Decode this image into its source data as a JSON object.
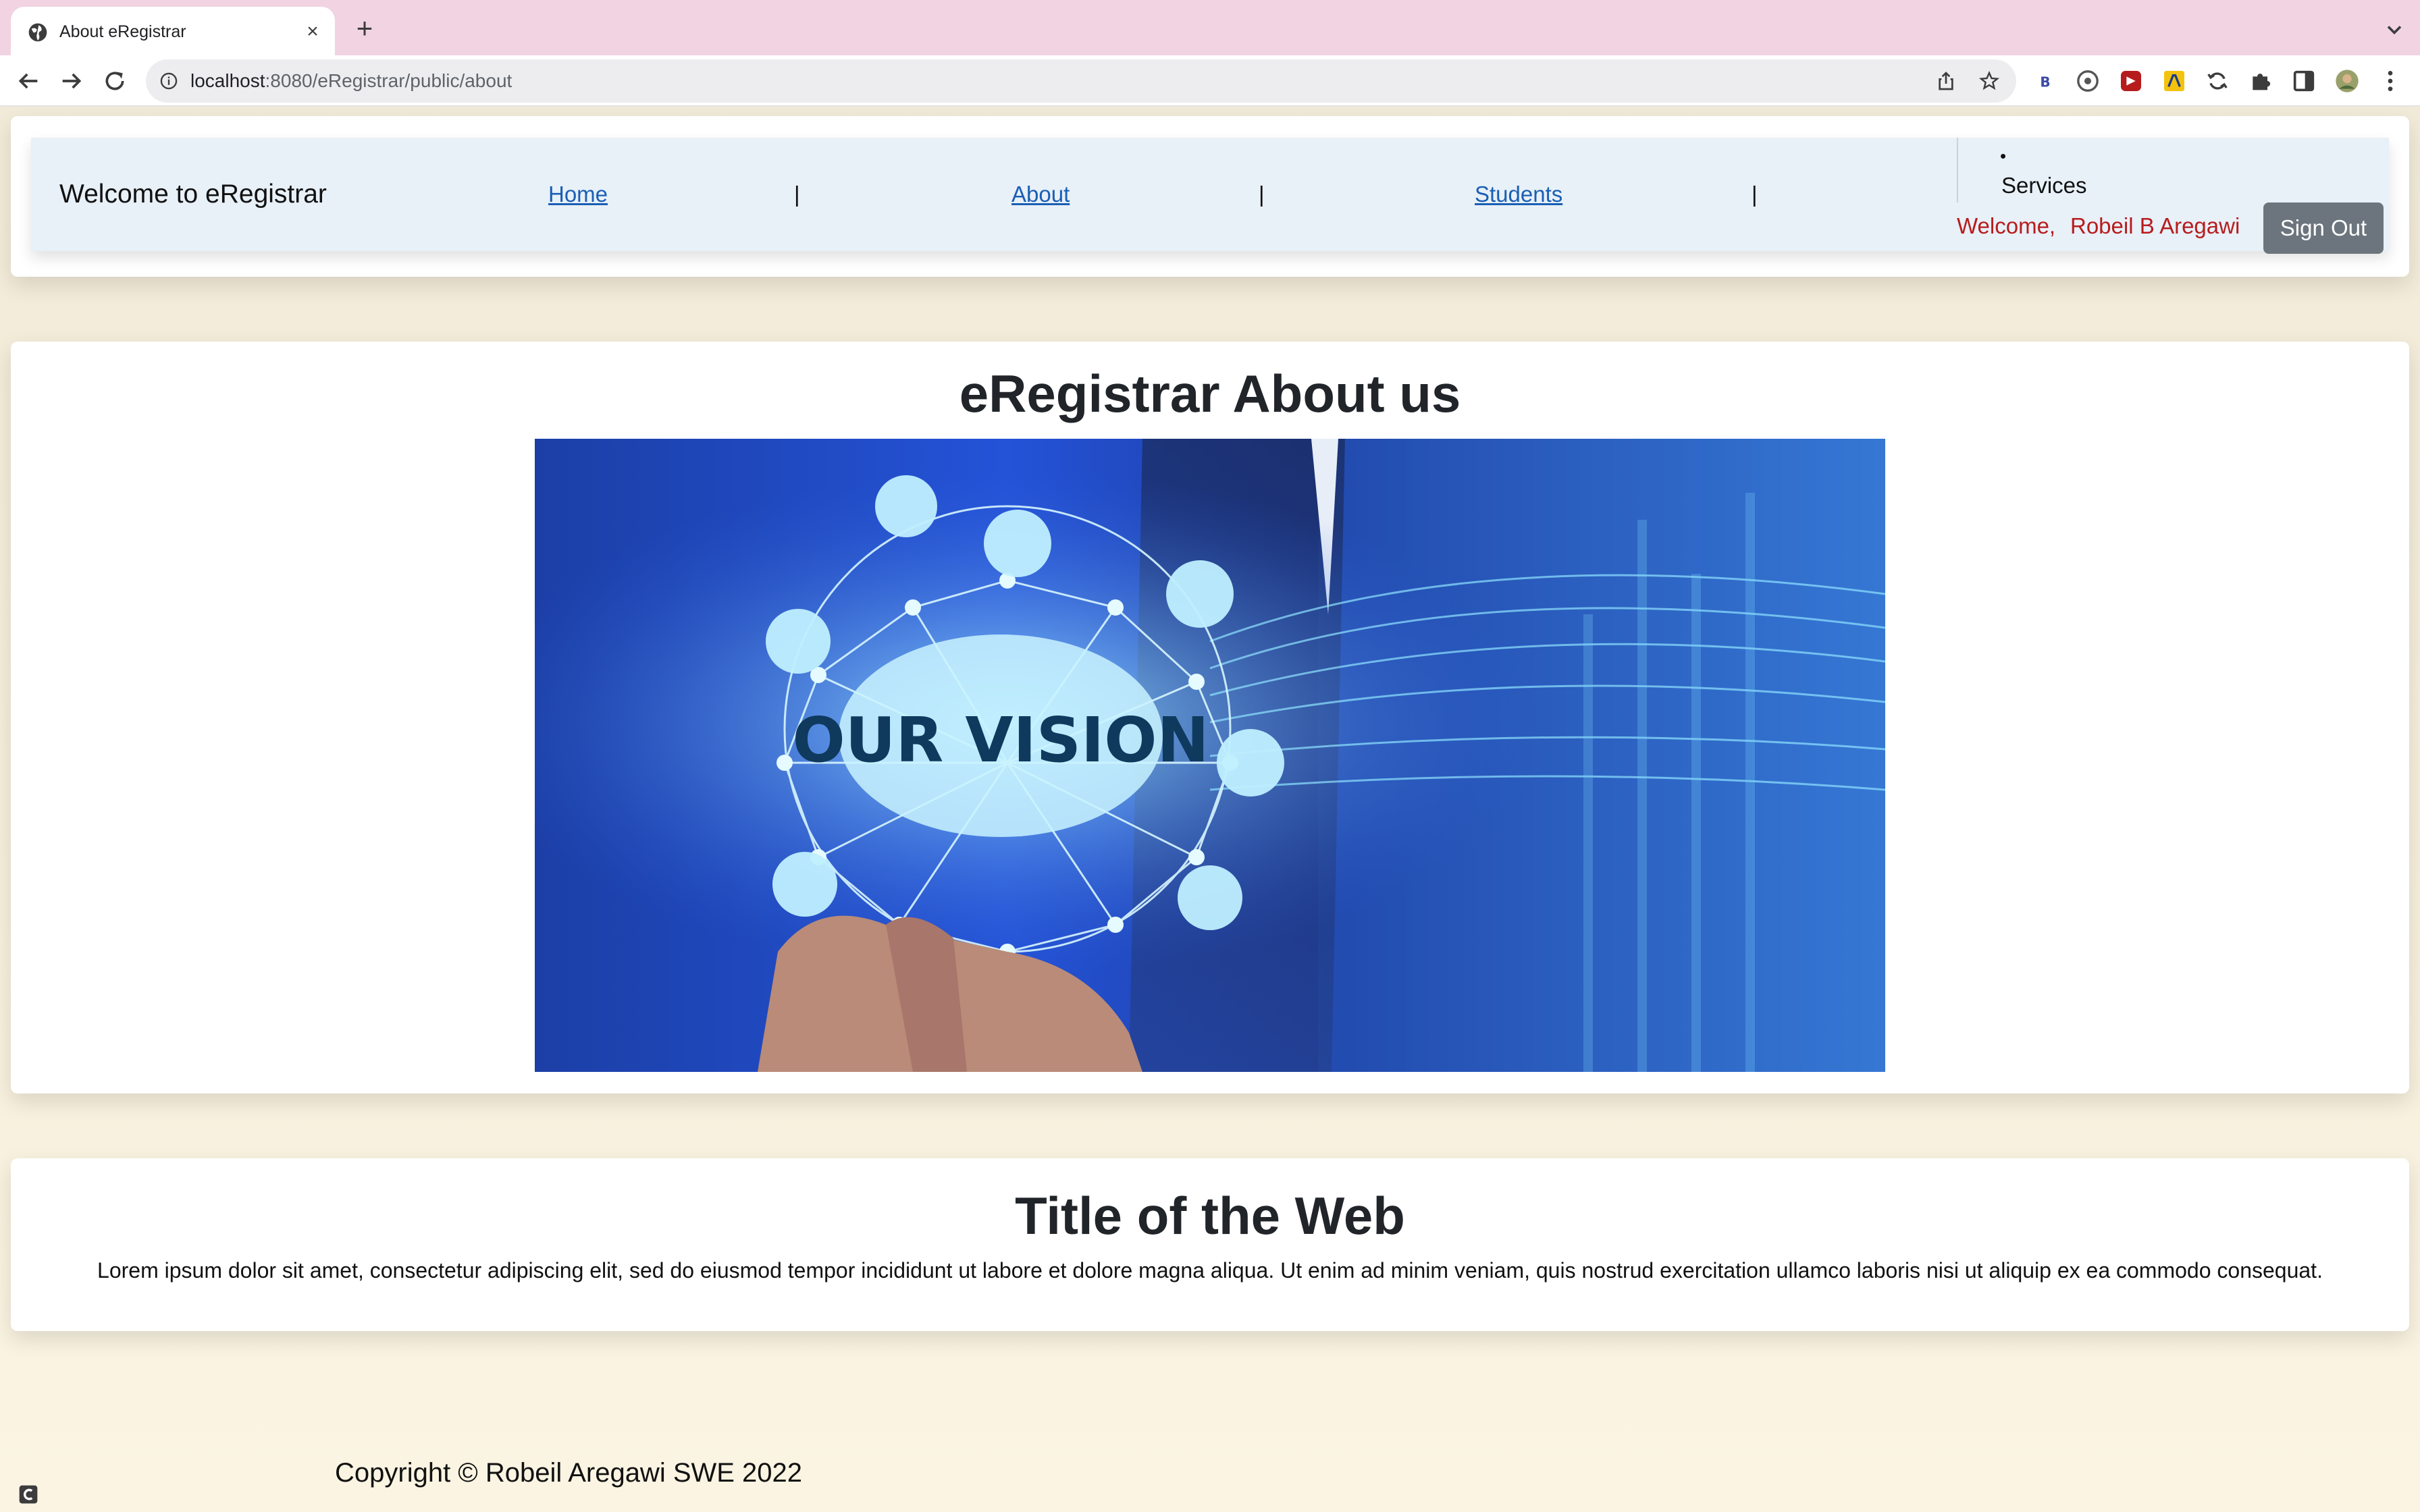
{
  "browser": {
    "tab_title": "About eRegistrar",
    "url_host": "localhost",
    "url_rest": ":8080/eRegistrar/public/about"
  },
  "nav": {
    "brand": "Welcome to eRegistrar",
    "links": [
      "Home",
      "About",
      "Students"
    ],
    "separator": "|",
    "bullet": "•",
    "services": "Services",
    "welcome": "Welcome,",
    "user": "Robeil B Aregawi",
    "signout": "Sign Out"
  },
  "about": {
    "title": "eRegistrar About us",
    "image_text": "OUR VISION"
  },
  "web": {
    "title": "Title of the Web",
    "text": "Lorem ipsum dolor sit amet, consectetur adipiscing elit, sed do eiusmod tempor incididunt ut labore et dolore magna aliqua. Ut enim ad minim veniam, quis nostrud exercitation ullamco laboris nisi ut aliquip ex ea commodo consequat."
  },
  "footer": {
    "copyright": "Copyright © Robeil Aregawi SWE 2022"
  },
  "colors": {
    "tabstrip": "#f1d3e1",
    "navbar": "#e8f0f8",
    "link": "#1a5fb4",
    "welcome": "#b71c1c",
    "signout": "#6c757d"
  }
}
